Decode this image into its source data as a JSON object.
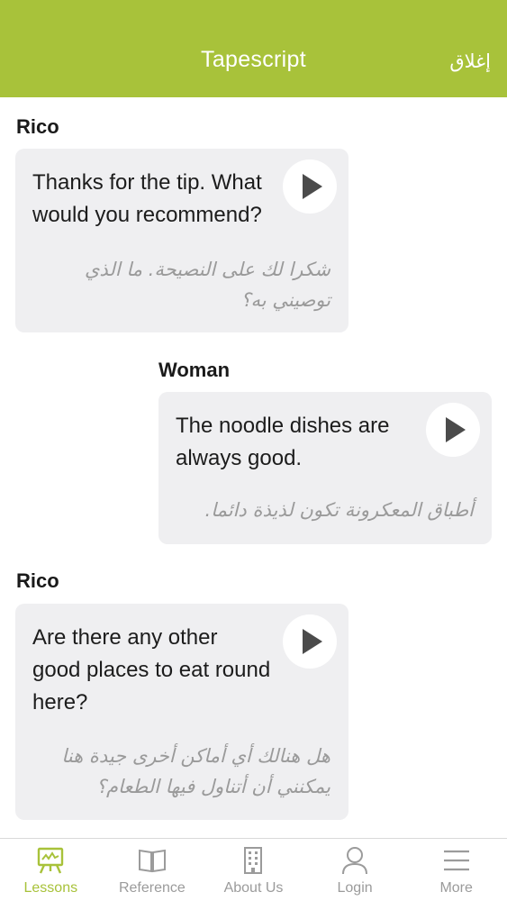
{
  "header": {
    "title": "Tapescript",
    "close_label": "إغلاق"
  },
  "colors": {
    "accent": "#a8c23a",
    "bubble": "#efeff1",
    "inactive_tab": "#9b9b9b"
  },
  "messages": [
    {
      "speaker": "Rico",
      "english": [
        "Thanks for the tip. What",
        "would you recommend?"
      ],
      "arabic": [
        "شكرا لك على النصيحة. ما الذي",
        "توصيني به؟"
      ]
    },
    {
      "speaker": "Woman",
      "english": [
        "The noodle dishes are",
        "always good."
      ],
      "arabic": [
        "أطباق المعكرونة تكون لذيذة دائما."
      ]
    },
    {
      "speaker": "Rico",
      "english": [
        "Are there any other",
        "good places to eat round",
        "here?"
      ],
      "arabic": [
        "هل هنالك أي أماكن أخرى جيدة هنا",
        "يمكنني أن أتناول فيها الطعام؟"
      ]
    }
  ],
  "tabs": [
    {
      "label": "Lessons",
      "icon": "easel-icon",
      "active": true
    },
    {
      "label": "Reference",
      "icon": "book-icon",
      "active": false
    },
    {
      "label": "About Us",
      "icon": "building-icon",
      "active": false
    },
    {
      "label": "Login",
      "icon": "user-icon",
      "active": false
    },
    {
      "label": "More",
      "icon": "menu-icon",
      "active": false
    }
  ]
}
